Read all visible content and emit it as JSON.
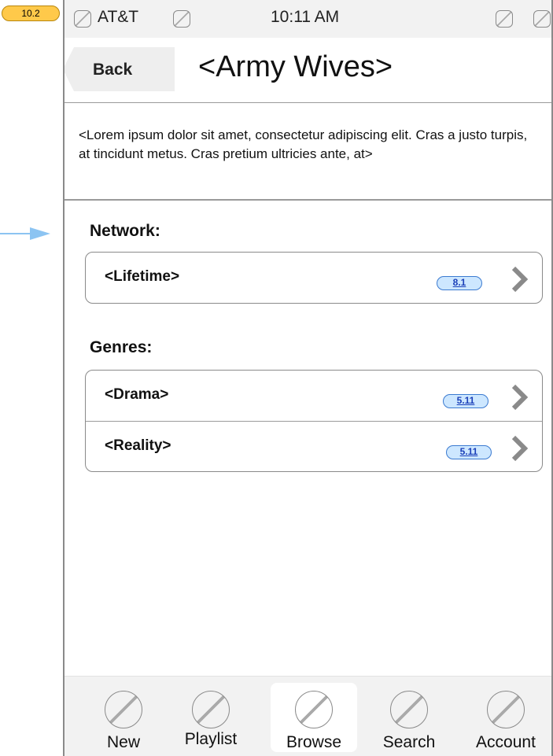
{
  "page_badge": "10.2",
  "status_bar": {
    "carrier": "AT&T",
    "time": "10:11 AM"
  },
  "nav": {
    "back_label": "Back",
    "title": "<Army Wives>"
  },
  "description": "<Lorem ipsum dolor sit amet, consectetur adipiscing elit. Cras a justo turpis, at tincidunt metus. Cras pretium ultricies ante, at>",
  "network": {
    "label": "Network:",
    "items": [
      {
        "label": "<Lifetime>",
        "badge": "8.1"
      }
    ]
  },
  "genres": {
    "label": "Genres:",
    "items": [
      {
        "label": "<Drama>",
        "badge": "5.11"
      },
      {
        "label": "<Reality>",
        "badge": "5.11"
      }
    ]
  },
  "tab_bar": {
    "tabs": [
      {
        "label": "New"
      },
      {
        "label": "Playlist"
      },
      {
        "label": "Browse",
        "active": true
      },
      {
        "label": "Search"
      },
      {
        "label": "Account"
      }
    ]
  },
  "colors": {
    "badge_fill": "#cde7ff",
    "badge_border": "#3b7ad0",
    "page_badge": "#ffc94a",
    "arrow": "#8cc4f2"
  }
}
